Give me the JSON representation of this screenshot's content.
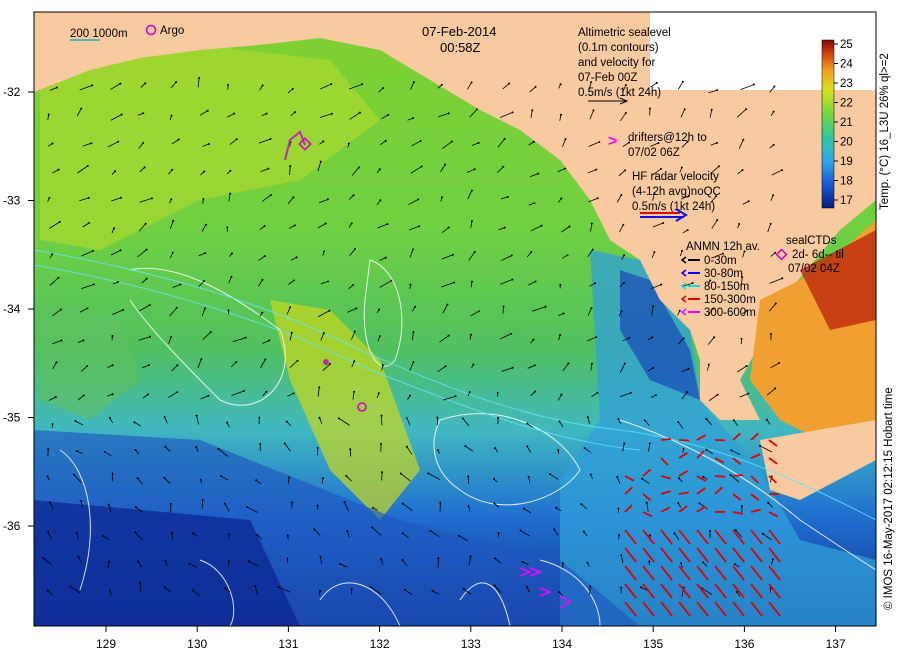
{
  "title": {
    "date": "07-Feb-2014",
    "time": "00:58Z"
  },
  "scale_legend": {
    "depths": "200  1000m",
    "argo_label": "Argo"
  },
  "altimetry": {
    "lines": [
      "Altimetric sealevel",
      "(0.1m contours)",
      "and velocity for",
      "07-Feb 00Z",
      "0.5m/s (1kt 24h)"
    ]
  },
  "drifters": {
    "symbol": ">",
    "lines": [
      "drifters@12h to",
      "07/02 06Z"
    ]
  },
  "hf_radar": {
    "lines": [
      "HF radar velocity",
      "(4-12h avg)noQC",
      "0.5m/s (1kt 24h)"
    ]
  },
  "anmn": {
    "title": "ANMN 12h av.",
    "items": [
      {
        "label": "0-30m",
        "color": "#000000"
      },
      {
        "label": "30-80m",
        "color": "#0000ff"
      },
      {
        "label": "80-150m",
        "color": "#00e0e0"
      },
      {
        "label": "150-300m",
        "color": "#e00000"
      },
      {
        "label": "300-600m",
        "color": "#ff00ff"
      }
    ]
  },
  "seal_ctds": {
    "title": "sealCTDs",
    "lines": [
      "2d- 6d-- til",
      "07/02 04Z"
    ]
  },
  "colorbar": {
    "label": "Temp. (°C) 16_L3U 26% ql>=2",
    "ticks": [
      25,
      24,
      23,
      22,
      21,
      20,
      19,
      18,
      17
    ]
  },
  "axes": {
    "x_ticks": [
      "129",
      "130",
      "131",
      "132",
      "133",
      "134",
      "135",
      "136",
      "137"
    ],
    "y_ticks": [
      "-32",
      "-33",
      "-34",
      "-35",
      "-36"
    ]
  },
  "credit": "© IMOS 16-May-2017 02:12:15 Hobart time",
  "colors": {
    "land": "#f9c9a0",
    "warm": "#f0e020",
    "green": "#60d040",
    "cyan": "#30b0e0",
    "deep": "#1030a0"
  }
}
